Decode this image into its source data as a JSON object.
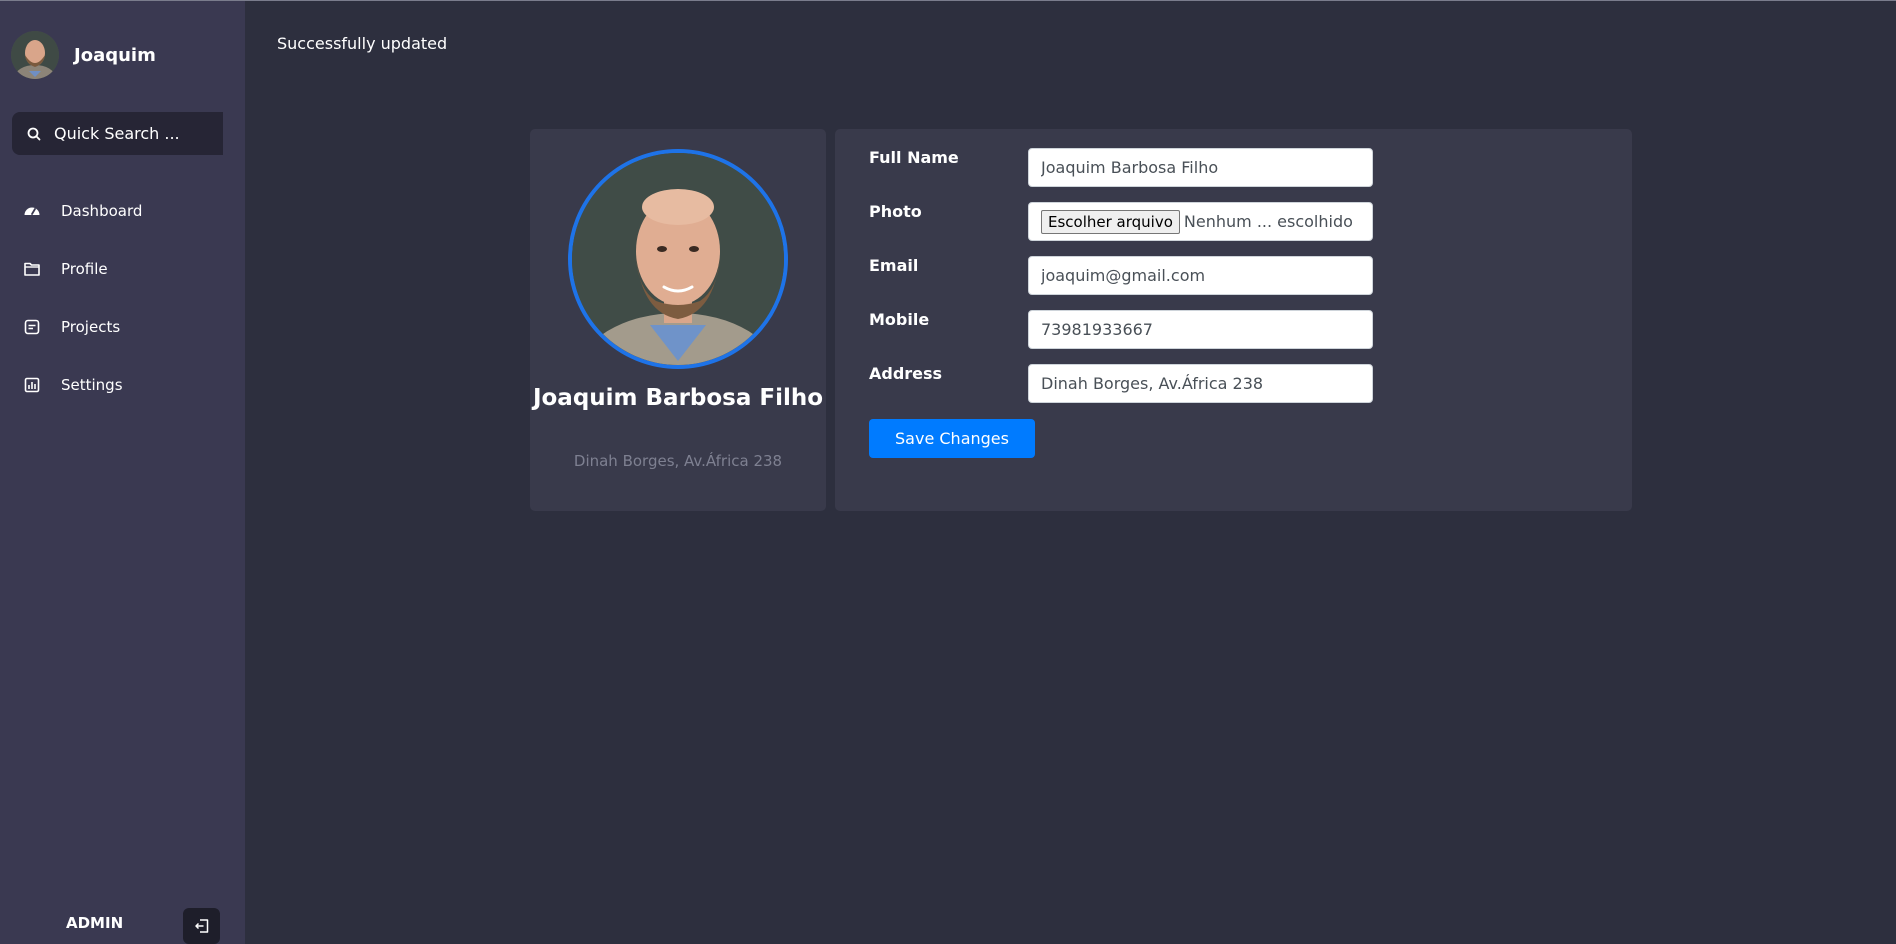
{
  "sidebar": {
    "user_name": "Joaquim",
    "search_placeholder": "Quick Search ...",
    "items": [
      {
        "label": "Dashboard",
        "icon": "gauge-icon"
      },
      {
        "label": "Profile",
        "icon": "folder-icon"
      },
      {
        "label": "Projects",
        "icon": "note-icon"
      },
      {
        "label": "Settings",
        "icon": "bar-chart-icon"
      }
    ],
    "role": "ADMIN",
    "logout_icon": "logout-icon"
  },
  "status_message": "Successfully updated",
  "profile_card": {
    "name": "Joaquim Barbosa Filho",
    "address": "Dinah Borges, Av.África 238"
  },
  "form": {
    "full_name_label": "Full Name",
    "full_name_value": "Joaquim Barbosa Filho",
    "photo_label": "Photo",
    "photo_button": "Escolher arquivo",
    "photo_status": "Nenhum ... escolhido",
    "email_label": "Email",
    "email_value": "joaquim@gmail.com",
    "mobile_label": "Mobile",
    "mobile_value": "73981933667",
    "address_label": "Address",
    "address_value": "Dinah Borges, Av.África 238",
    "save_label": "Save Changes"
  },
  "colors": {
    "sidebar_bg": "#3a3951",
    "main_bg": "#2d2f3e",
    "card_bg": "#393a4b",
    "accent": "#007bff"
  }
}
